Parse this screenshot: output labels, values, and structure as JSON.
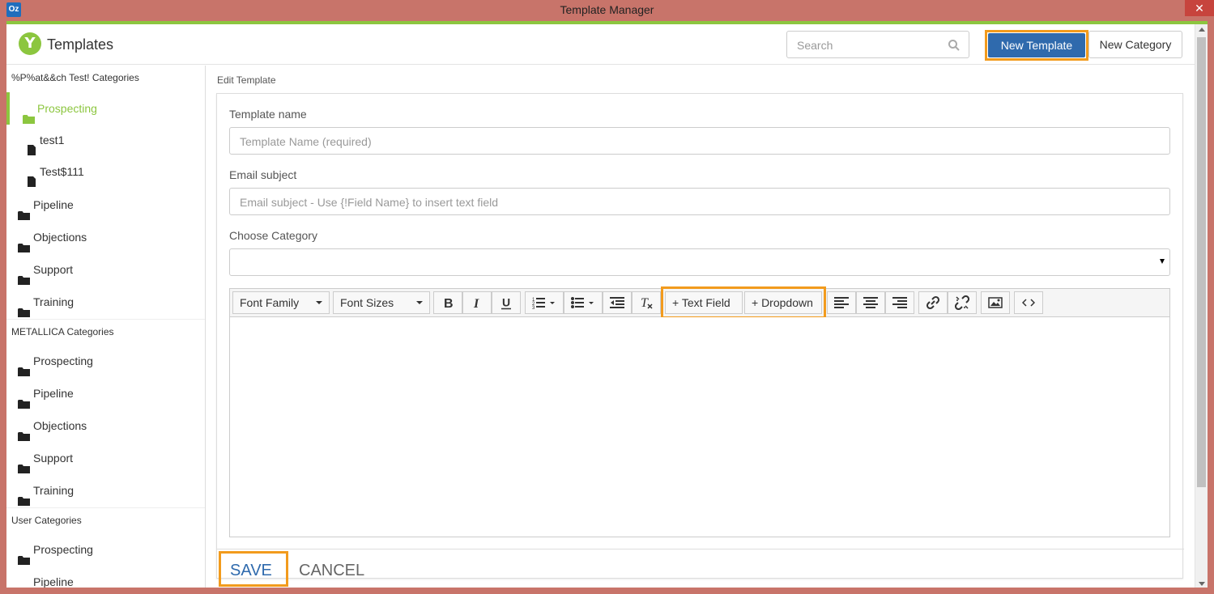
{
  "window": {
    "title": "Template Manager",
    "app_icon_text": "Oz",
    "close_glyph": "✕"
  },
  "header": {
    "logo_glyph": "Y",
    "app_name": "Templates",
    "search_placeholder": "Search",
    "new_template_label": "New Template",
    "new_category_label": "New Category"
  },
  "sidebar": {
    "groups": [
      {
        "title": "%P%at&&ch Test! Categories",
        "items": [
          {
            "label": "Prospecting",
            "type": "folder",
            "active": true
          },
          {
            "label": "test1",
            "type": "file"
          },
          {
            "label": "Test$111",
            "type": "file"
          },
          {
            "label": "Pipeline",
            "type": "folder"
          },
          {
            "label": "Objections",
            "type": "folder"
          },
          {
            "label": "Support",
            "type": "folder"
          },
          {
            "label": "Training",
            "type": "folder"
          }
        ]
      },
      {
        "title": "METALLICA Categories",
        "items": [
          {
            "label": "Prospecting",
            "type": "folder"
          },
          {
            "label": "Pipeline",
            "type": "folder"
          },
          {
            "label": "Objections",
            "type": "folder"
          },
          {
            "label": "Support",
            "type": "folder"
          },
          {
            "label": "Training",
            "type": "folder"
          }
        ]
      },
      {
        "title": "User Categories",
        "items": [
          {
            "label": "Prospecting",
            "type": "folder"
          },
          {
            "label": "Pipeline",
            "type": "folder"
          }
        ]
      }
    ]
  },
  "main": {
    "section_label": "Edit Template",
    "template_name_label": "Template name",
    "template_name_placeholder": "Template Name (required)",
    "email_subject_label": "Email subject",
    "email_subject_placeholder": "Email subject - Use {!Field Name} to insert text field",
    "category_label": "Choose Category",
    "category_value": "",
    "toolbar": {
      "font_family": "Font Family",
      "font_sizes": "Font Sizes",
      "text_field": "+ Text Field",
      "dropdown": "+ Dropdown",
      "icons": [
        "bold-icon",
        "italic-icon",
        "underline-icon",
        "ordered-list-icon",
        "unordered-list-icon",
        "outdent-icon",
        "clear-format-icon",
        "align-left-icon",
        "align-center-icon",
        "align-right-icon",
        "link-icon",
        "unlink-icon",
        "image-icon",
        "code-view-icon"
      ]
    },
    "save_label": "SAVE",
    "cancel_label": "CANCEL"
  },
  "colors": {
    "accent_green": "#8cc63f",
    "primary_blue": "#2f6aad",
    "highlight_orange": "#f29b1d",
    "window_frame": "#c8746a"
  }
}
